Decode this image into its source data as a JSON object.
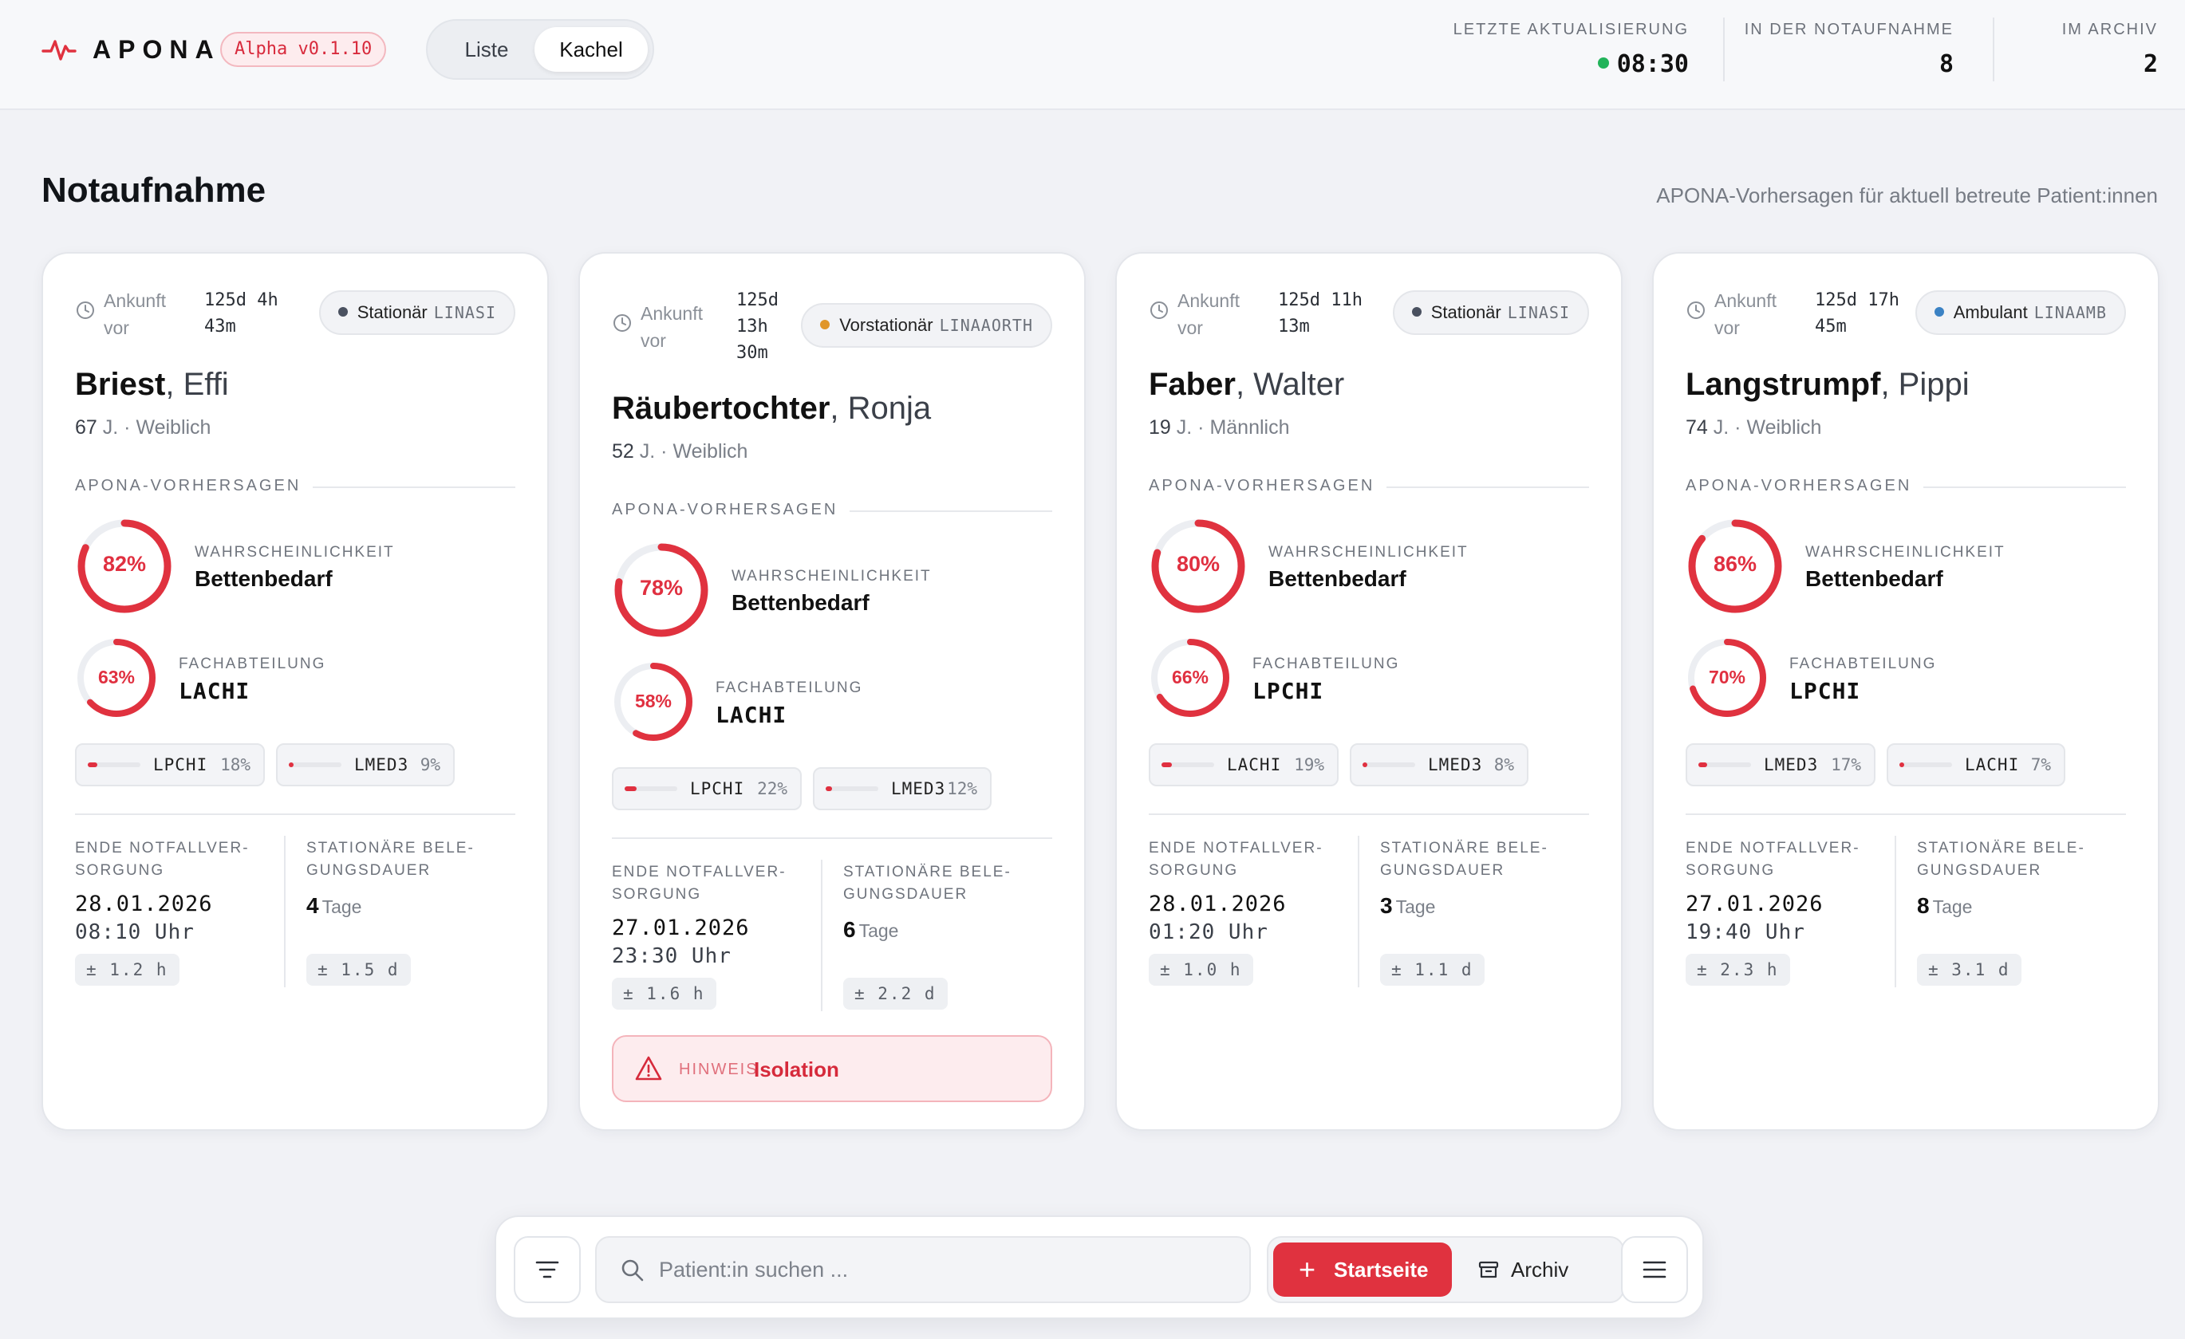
{
  "app": {
    "name": "APONA",
    "version": "Alpha v0.1.10",
    "accent": "#e0323f"
  },
  "view_toggle": {
    "list_label": "Liste",
    "tile_label": "Kachel",
    "selected": "Kachel"
  },
  "stats": {
    "last_update_label": "LETZTE AKTUALISIERUNG",
    "last_update_value": "08:30",
    "in_er_label": "IN DER NOTAUFNAHME",
    "in_er_value": "8",
    "archive_label": "IM ARCHIV",
    "archive_value": "2"
  },
  "page": {
    "title": "Notaufnahme",
    "subtitle": "APONA-Vorhersagen für aktuell betreute Patient:innen"
  },
  "labels": {
    "arrival": "Ankunft vor",
    "predictions": "APONA-VORHERSAGEN",
    "probability": "WAHRSCHEINLICHKEIT",
    "bed_need": "Bettenbedarf",
    "department": "FACHABTEILUNG",
    "end_care": "ENDE NOTFALLVER-SORGUNG",
    "stay_duration": "STATIONÄRE BELE-GUNGSDAUER",
    "days_unit": "Tage",
    "hint": "HINWEIS"
  },
  "patients": [
    {
      "arrival_l1": "125d 4h",
      "arrival_l2": "43m",
      "arrival_l3": "",
      "status": "Stationär",
      "status_code": "LINASI",
      "status_color": "#4a5160",
      "last_name": "Briest",
      "first_name": "Effi",
      "age": "67",
      "age_unit": "J.",
      "sex": "Weiblich",
      "bed_prob": 82,
      "bed_prob_label": "82%",
      "dept_prob": 63,
      "dept_prob_label": "63%",
      "dept": "LACHI",
      "alt": [
        {
          "code": "LPCHI",
          "pct": 18,
          "pct_label": "18%"
        },
        {
          "code": "LMED3",
          "pct": 9,
          "pct_label": "9%"
        }
      ],
      "end_date": "28.01.2026",
      "end_time": "08:10 Uhr",
      "end_err": "± 1.2 h",
      "stay_days": "4",
      "stay_err": "± 1.5 d",
      "hint": ""
    },
    {
      "arrival_l1": "125d",
      "arrival_l2": "13h",
      "arrival_l3": "30m",
      "status": "Vorstationär",
      "status_code": "LINAAORTH",
      "status_color": "#e0962a",
      "last_name": "Räubertochter",
      "first_name": "Ronja",
      "age": "52",
      "age_unit": "J.",
      "sex": "Weiblich",
      "bed_prob": 78,
      "bed_prob_label": "78%",
      "dept_prob": 58,
      "dept_prob_label": "58%",
      "dept": "LACHI",
      "alt": [
        {
          "code": "LPCHI",
          "pct": 22,
          "pct_label": "22%"
        },
        {
          "code": "LMED3",
          "pct": 12,
          "pct_label": "12%"
        }
      ],
      "end_date": "27.01.2026",
      "end_time": "23:30 Uhr",
      "end_err": "± 1.6 h",
      "stay_days": "6",
      "stay_err": "± 2.2 d",
      "hint": "Isolation"
    },
    {
      "arrival_l1": "125d 11h",
      "arrival_l2": "13m",
      "arrival_l3": "",
      "status": "Stationär",
      "status_code": "LINASI",
      "status_color": "#4a5160",
      "last_name": "Faber",
      "first_name": "Walter",
      "age": "19",
      "age_unit": "J.",
      "sex": "Männlich",
      "bed_prob": 80,
      "bed_prob_label": "80%",
      "dept_prob": 66,
      "dept_prob_label": "66%",
      "dept": "LPCHI",
      "alt": [
        {
          "code": "LACHI",
          "pct": 19,
          "pct_label": "19%"
        },
        {
          "code": "LMED3",
          "pct": 8,
          "pct_label": "8%"
        }
      ],
      "end_date": "28.01.2026",
      "end_time": "01:20 Uhr",
      "end_err": "± 1.0 h",
      "stay_days": "3",
      "stay_err": "± 1.1 d",
      "hint": ""
    },
    {
      "arrival_l1": "125d 17h",
      "arrival_l2": "45m",
      "arrival_l3": "",
      "status": "Ambulant",
      "status_code": "LINAAMB",
      "status_color": "#3b82c4",
      "last_name": "Langstrumpf",
      "first_name": "Pippi",
      "age": "74",
      "age_unit": "J.",
      "sex": "Weiblich",
      "bed_prob": 86,
      "bed_prob_label": "86%",
      "dept_prob": 70,
      "dept_prob_label": "70%",
      "dept": "LPCHI",
      "alt": [
        {
          "code": "LMED3",
          "pct": 17,
          "pct_label": "17%"
        },
        {
          "code": "LACHI",
          "pct": 7,
          "pct_label": "7%"
        }
      ],
      "end_date": "27.01.2026",
      "end_time": "19:40 Uhr",
      "end_err": "± 2.3 h",
      "stay_days": "8",
      "stay_err": "± 3.1 d",
      "hint": ""
    }
  ],
  "bottom_bar": {
    "filter_icon": "filter-icon",
    "search_placeholder": "Patient:in suchen ...",
    "start_label": "Startseite",
    "archive_label": "Archiv",
    "menu_icon": "menu-icon"
  }
}
